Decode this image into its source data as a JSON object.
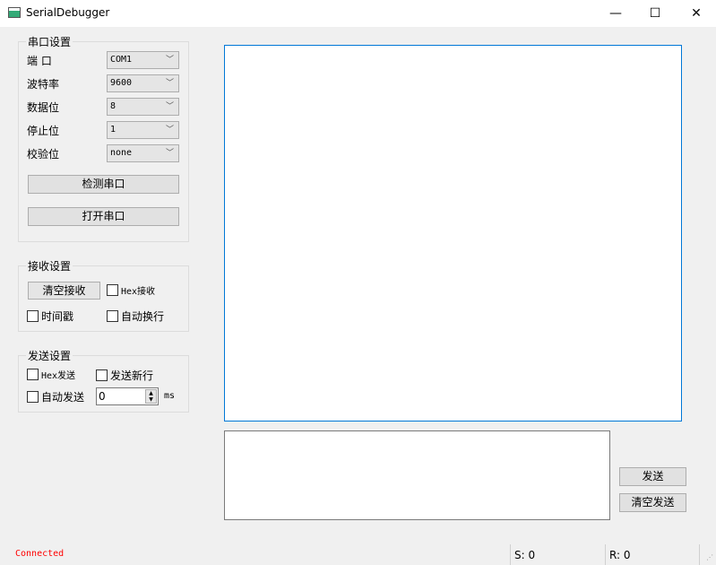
{
  "window": {
    "title": "SerialDebugger",
    "minimize": "—",
    "maximize": "☐",
    "close": "✕"
  },
  "serial": {
    "title": "串口设置",
    "port_label": "端 口",
    "port": "COM1",
    "baud_label": "波特率",
    "baud": "9600",
    "data_label": "数据位",
    "data": "8",
    "stop_label": "停止位",
    "stop": "1",
    "parity_label": "校验位",
    "parity": "none",
    "detect": "检测串口",
    "open": "打开串口"
  },
  "receive": {
    "title": "接收设置",
    "clear": "清空接收",
    "hex": "Hex接收",
    "timestamp": "时间戳",
    "autowrap": "自动换行"
  },
  "send": {
    "title": "发送设置",
    "hex": "Hex发送",
    "newline": "发送新行",
    "auto": "自动发送",
    "interval": "0",
    "unit": "ms",
    "send_btn": "发送",
    "clear_btn": "清空发送"
  },
  "status": {
    "state": "Connected",
    "state_color": "#ff0000",
    "sent": "S: 0",
    "received": "R: 0"
  }
}
